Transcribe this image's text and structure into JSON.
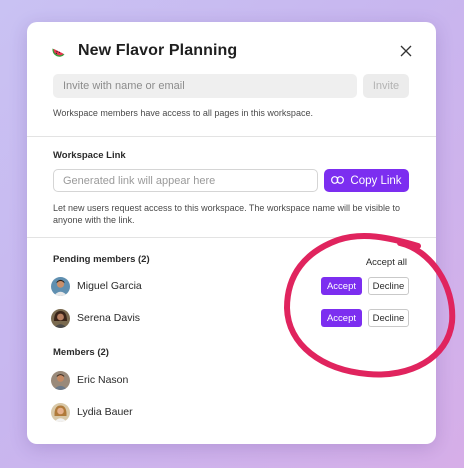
{
  "dialog": {
    "title": "New Flavor Planning",
    "icon": "watermelon-icon",
    "close_icon": "close-icon"
  },
  "invite": {
    "placeholder": "Invite with name or email",
    "button_label": "Invite",
    "hint": "Workspace members have access to all pages in this workspace."
  },
  "workspace_link": {
    "label": "Workspace Link",
    "placeholder": "Generated link will appear here",
    "copy_label": "Copy Link",
    "copy_icon": "link-icon",
    "hint_line1": "Let new users request access to this workspace. The workspace name will be visible to",
    "hint_line2": "anyone with the link."
  },
  "pending": {
    "label": "Pending members (2)",
    "accept_all_label": "Accept all",
    "members": [
      {
        "name": "Miguel Garcia",
        "accept_label": "Accept",
        "decline_label": "Decline"
      },
      {
        "name": "Serena Davis",
        "accept_label": "Accept",
        "decline_label": "Decline"
      }
    ]
  },
  "members": {
    "label": "Members (2)",
    "list": [
      {
        "name": "Eric Nason"
      },
      {
        "name": "Lydia Bauer"
      }
    ]
  },
  "colors": {
    "accent": "#7c2ef0",
    "annotation_circle": "#e0245e"
  }
}
